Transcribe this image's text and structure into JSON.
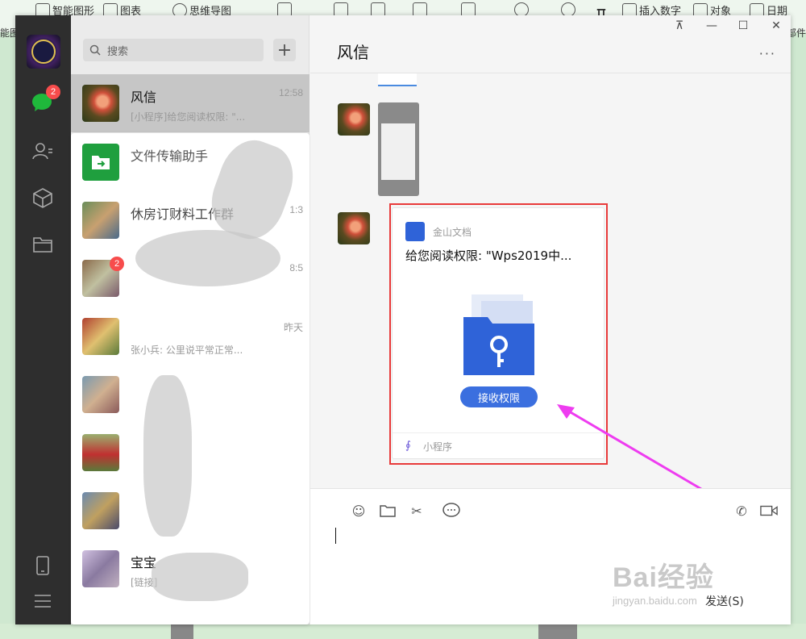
{
  "wps": {
    "tools": [
      "智能图形",
      "图表",
      "思维导图",
      "插入数字",
      "对象",
      "日期"
    ],
    "left_label": "能图",
    "right_label": "部件"
  },
  "sidebar": {
    "unread_badge": "2"
  },
  "search": {
    "placeholder": "搜索",
    "add_label": "+"
  },
  "chats": [
    {
      "name": "风信",
      "time": "12:58",
      "preview": "[小程序]给您阅读权限: \"...",
      "active": true
    },
    {
      "name": "文件传输助手",
      "time": "",
      "preview": ""
    },
    {
      "name": "休房订财料工作群",
      "time": "1:3",
      "preview": ""
    },
    {
      "name": "",
      "time": "8:5",
      "preview": "",
      "badge": "2"
    },
    {
      "name": "",
      "time": "昨天",
      "preview": "张小兵: 公里说平常正常..."
    },
    {
      "name": "",
      "time": "",
      "preview": ""
    },
    {
      "name": "",
      "time": "",
      "preview": ""
    },
    {
      "name": "",
      "time": "",
      "preview": ""
    },
    {
      "name": "宝宝",
      "time": "",
      "preview": "[链接]"
    }
  ],
  "conversation": {
    "title": "风信",
    "window_controls": [
      "⊼",
      "—",
      "☐",
      "✕"
    ],
    "more": "···"
  },
  "card": {
    "brand": "金山文档",
    "title": "给您阅读权限: \"Wps2019中...",
    "button": "接收权限",
    "footer": "小程序",
    "brand_color": "#2f63d8"
  },
  "input": {
    "send_label": "发送(S)"
  },
  "watermark": {
    "brand": "Bai经验",
    "url": "jingyan.baidu.com"
  }
}
